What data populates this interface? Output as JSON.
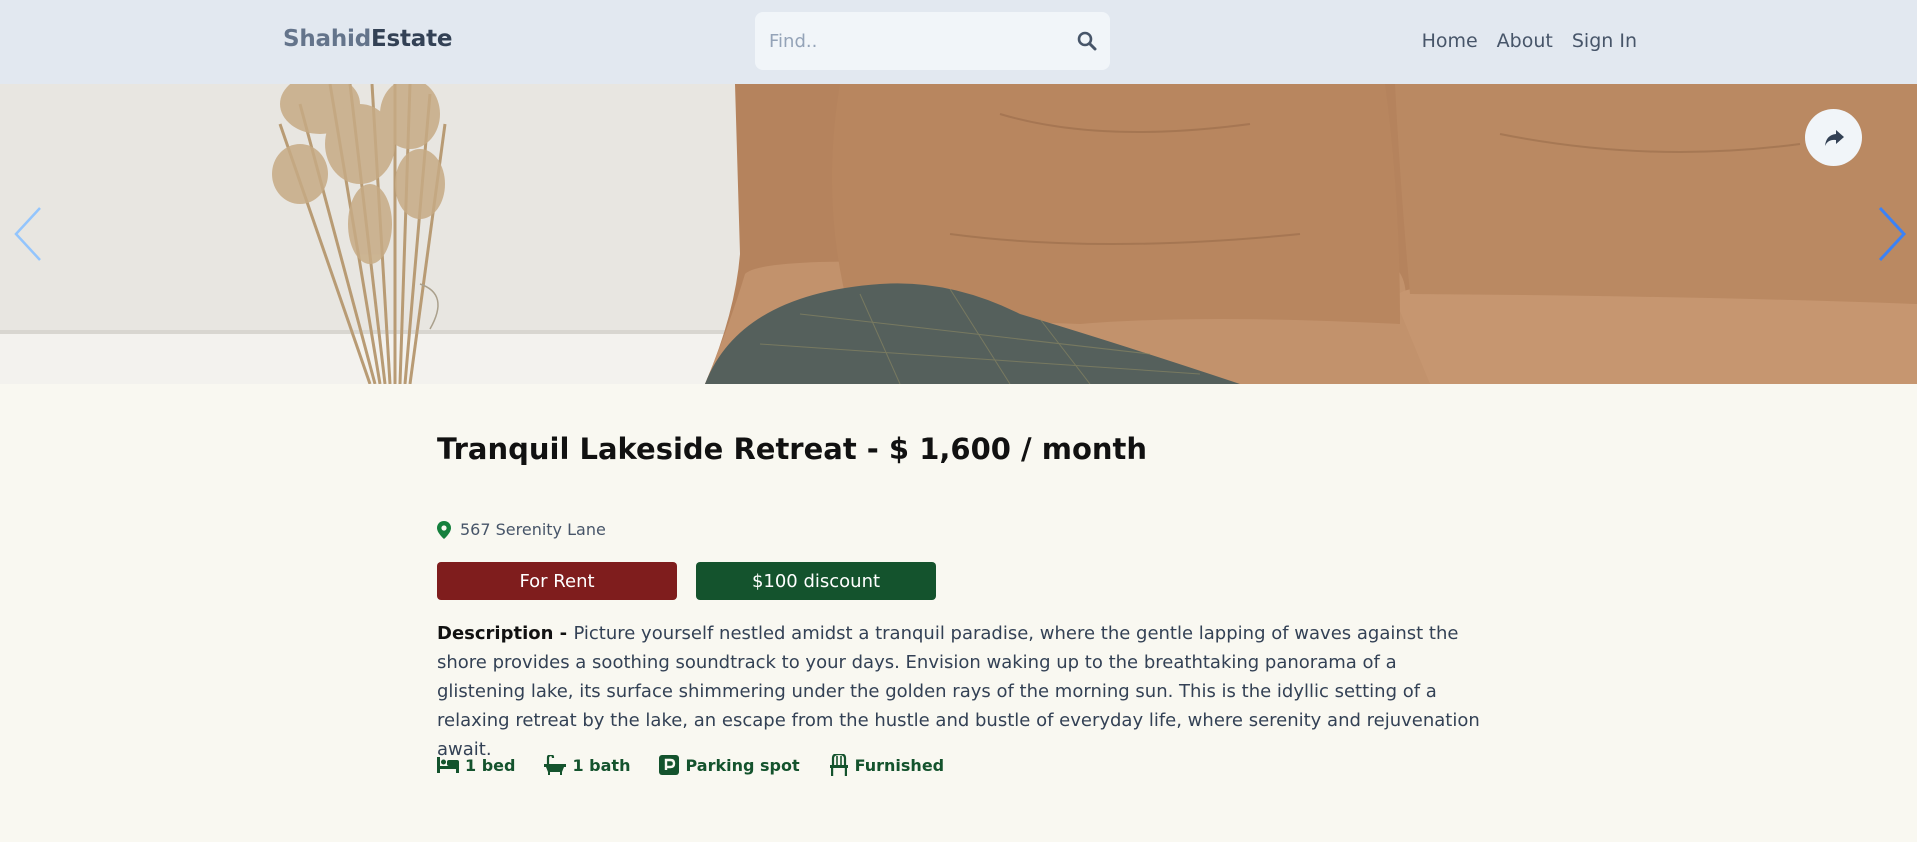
{
  "header": {
    "logo_part1": "Shahid",
    "logo_part2": "Estate",
    "search_placeholder": "Find..",
    "nav": [
      "Home",
      "About",
      "Sign In"
    ]
  },
  "hero": {
    "prev_icon": "chevron-left-icon",
    "next_icon": "chevron-right-icon",
    "share_icon": "share-icon"
  },
  "listing": {
    "title": "Tranquil Lakeside Retreat - $ 1,600 / month",
    "address": "567 Serenity Lane",
    "badges": {
      "type": "For Rent",
      "discount": "$100 discount"
    },
    "description_label": "Description - ",
    "description": "Picture yourself nestled amidst a tranquil paradise, where the gentle lapping of waves against the shore provides a soothing soundtrack to your days. Envision waking up to the breathtaking panorama of a glistening lake, its surface shimmering under the golden rays of the morning sun. This is the idyllic setting of a relaxing retreat by the lake, an escape from the hustle and bustle of everyday life, where serenity and rejuvenation await.",
    "features": [
      {
        "icon": "bed-icon",
        "label": "1 bed"
      },
      {
        "icon": "bath-icon",
        "label": "1 bath"
      },
      {
        "icon": "parking-icon",
        "label": "Parking spot"
      },
      {
        "icon": "chair-icon",
        "label": "Furnished"
      }
    ]
  },
  "colors": {
    "header_bg": "#e2e8f0",
    "page_bg": "#f9f8f1",
    "rent_badge": "#7f1d1d",
    "discount_badge": "#14532d",
    "accent_green": "#14532d",
    "arrow_blue": "#3b82f6"
  }
}
